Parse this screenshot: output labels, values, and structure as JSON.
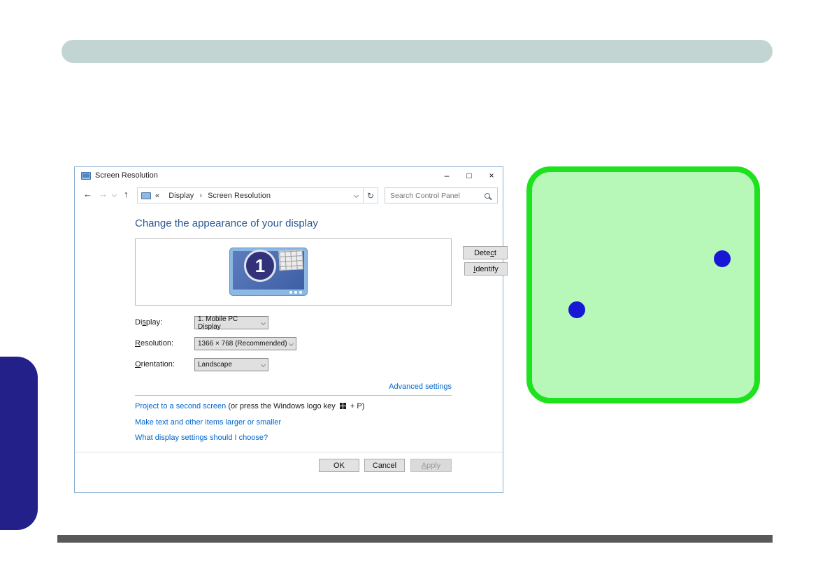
{
  "colors": {
    "callout_blue": "#1717d6",
    "highlight_green_border": "#1de21d",
    "highlight_green_fill": "#b7f7b7",
    "link_blue": "#0066cc",
    "heading_blue": "#2a5794",
    "side_tab_navy": "#232189",
    "top_bar_teal": "#c3d5d2",
    "bottom_bar_gray": "#59595b"
  },
  "window": {
    "title": "Screen Resolution",
    "controls": {
      "minimize": "–",
      "maximize": "□",
      "close": "×"
    },
    "nav": {
      "back": "←",
      "forward": "→",
      "up": "↑",
      "breadcrumb_prefix": "«",
      "breadcrumb_separator": "›",
      "breadcrumb": [
        {
          "label": "Display"
        },
        {
          "label": "Screen Resolution"
        }
      ],
      "refresh": "↻",
      "search_placeholder": "Search Control Panel"
    },
    "heading": "Change the appearance of your display",
    "preview": {
      "monitor_number": "1",
      "detect": {
        "pre": "Dete",
        "key": "c",
        "post": "t"
      },
      "identify": {
        "pre": "",
        "key": "I",
        "post": "dentify"
      }
    },
    "fields": {
      "display": {
        "label": {
          "pre": "Di",
          "key": "s",
          "post": "play:"
        },
        "value": "1. Mobile PC Display"
      },
      "resolution": {
        "label": {
          "pre": "",
          "key": "R",
          "post": "esolution:"
        },
        "value": "1366 × 768 (Recommended)"
      },
      "orientation": {
        "label": {
          "pre": "",
          "key": "O",
          "post": "rientation:"
        },
        "value": "Landscape"
      }
    },
    "advanced_settings_link": "Advanced settings",
    "project": {
      "link": "Project to a second screen",
      "text_before_icon": "(or press the Windows logo key",
      "text_after_icon": "+ P)"
    },
    "links": {
      "make_text": "Make text and other items larger or smaller",
      "what_settings": "What display settings should I choose?"
    },
    "buttons": {
      "ok": "OK",
      "cancel": "Cancel",
      "apply": {
        "pre": "",
        "key": "A",
        "post": "pply"
      }
    }
  }
}
